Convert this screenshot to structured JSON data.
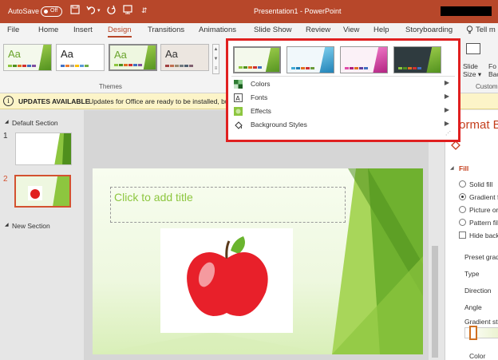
{
  "titlebar": {
    "autosave_label": "AutoSave",
    "autosave_state": "Off",
    "doc_title": "Presentation1  -  PowerPoint",
    "accent": "#b7472a"
  },
  "tabs": [
    "File",
    "Home",
    "Insert",
    "Design",
    "Transitions",
    "Animations",
    "Slide Show",
    "Review",
    "View",
    "Help",
    "Storyboarding",
    "Tell m"
  ],
  "active_tab": "Design",
  "ribbon": {
    "themes_label": "Themes",
    "slide_size_label": "Slide Size",
    "slide_size_arrow": "▾",
    "format_bg_partial": "Fo Back",
    "customize_label": "Custom"
  },
  "update_bar": {
    "title": "UPDATES AVAILABLE",
    "message": "Updates for Office are ready to be installed, bu"
  },
  "dropdown": {
    "menu": [
      {
        "label": "Colors",
        "icon": "colors-icon"
      },
      {
        "label": "Fonts",
        "icon": "fonts-icon"
      },
      {
        "label": "Effects",
        "icon": "effects-icon"
      },
      {
        "label": "Background Styles",
        "icon": "background-styles-icon"
      }
    ],
    "highlight_color": "#e02020"
  },
  "slides_pane": {
    "section1": "Default Section",
    "section2": "New Section",
    "slide_numbers": [
      "1",
      "2"
    ],
    "selected": "2"
  },
  "slide": {
    "title_placeholder": "Click to add title",
    "title_color": "#8dc63f"
  },
  "format_pane": {
    "title": "Format Ba",
    "fill_label": "Fill",
    "options": [
      "Solid fill",
      "Gradient f",
      "Picture or",
      "Pattern fil",
      "Hide back"
    ],
    "selected_option": "Gradient f",
    "fields": [
      "Preset gradi",
      "Type",
      "Direction",
      "Angle",
      "Gradient sto",
      "Color"
    ]
  }
}
